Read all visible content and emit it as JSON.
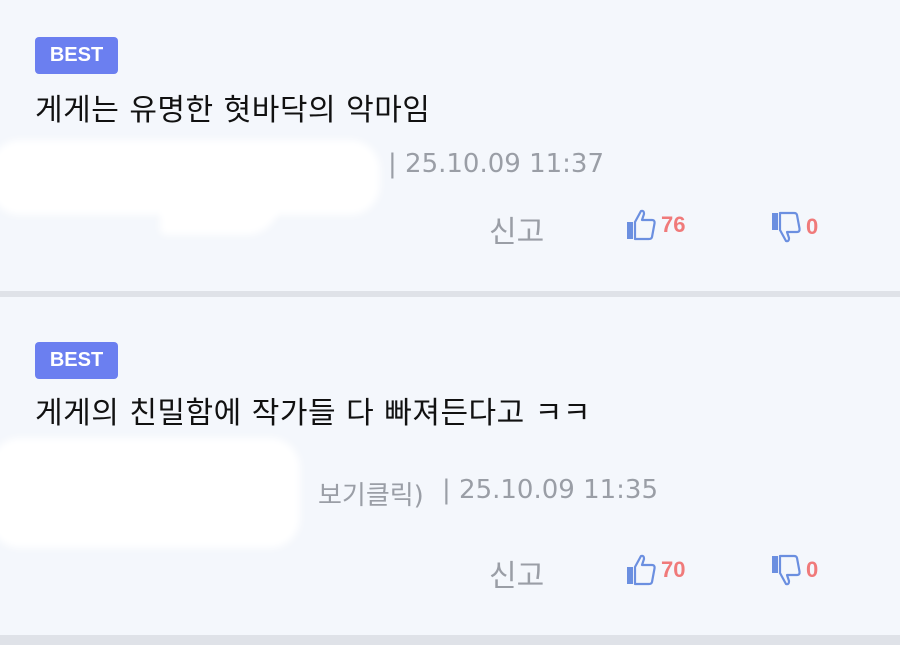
{
  "comments": [
    {
      "badge": "BEST",
      "text": "게게는 유명한 혓바닥의 악마임",
      "meta": "| 25.10.09 11:37",
      "report_label": "신고",
      "likes": "76",
      "dislikes": "0"
    },
    {
      "badge": "BEST",
      "text": "게게의 친밀함에 작가들 다 빠져든다고 ㅋㅋ",
      "meta_partial": "보기클릭)",
      "meta": "| 25.10.09 11:35",
      "report_label": "신고",
      "likes": "70",
      "dislikes": "0"
    }
  ],
  "colors": {
    "badge_bg": "#6b7ff0",
    "like_icon": "#6b8fe0",
    "count_text": "#f07a7a",
    "meta_text": "#9a9ea6",
    "background": "#f4f7fc"
  },
  "icons": {
    "like": "thumbs-up-icon",
    "dislike": "thumbs-down-icon"
  }
}
